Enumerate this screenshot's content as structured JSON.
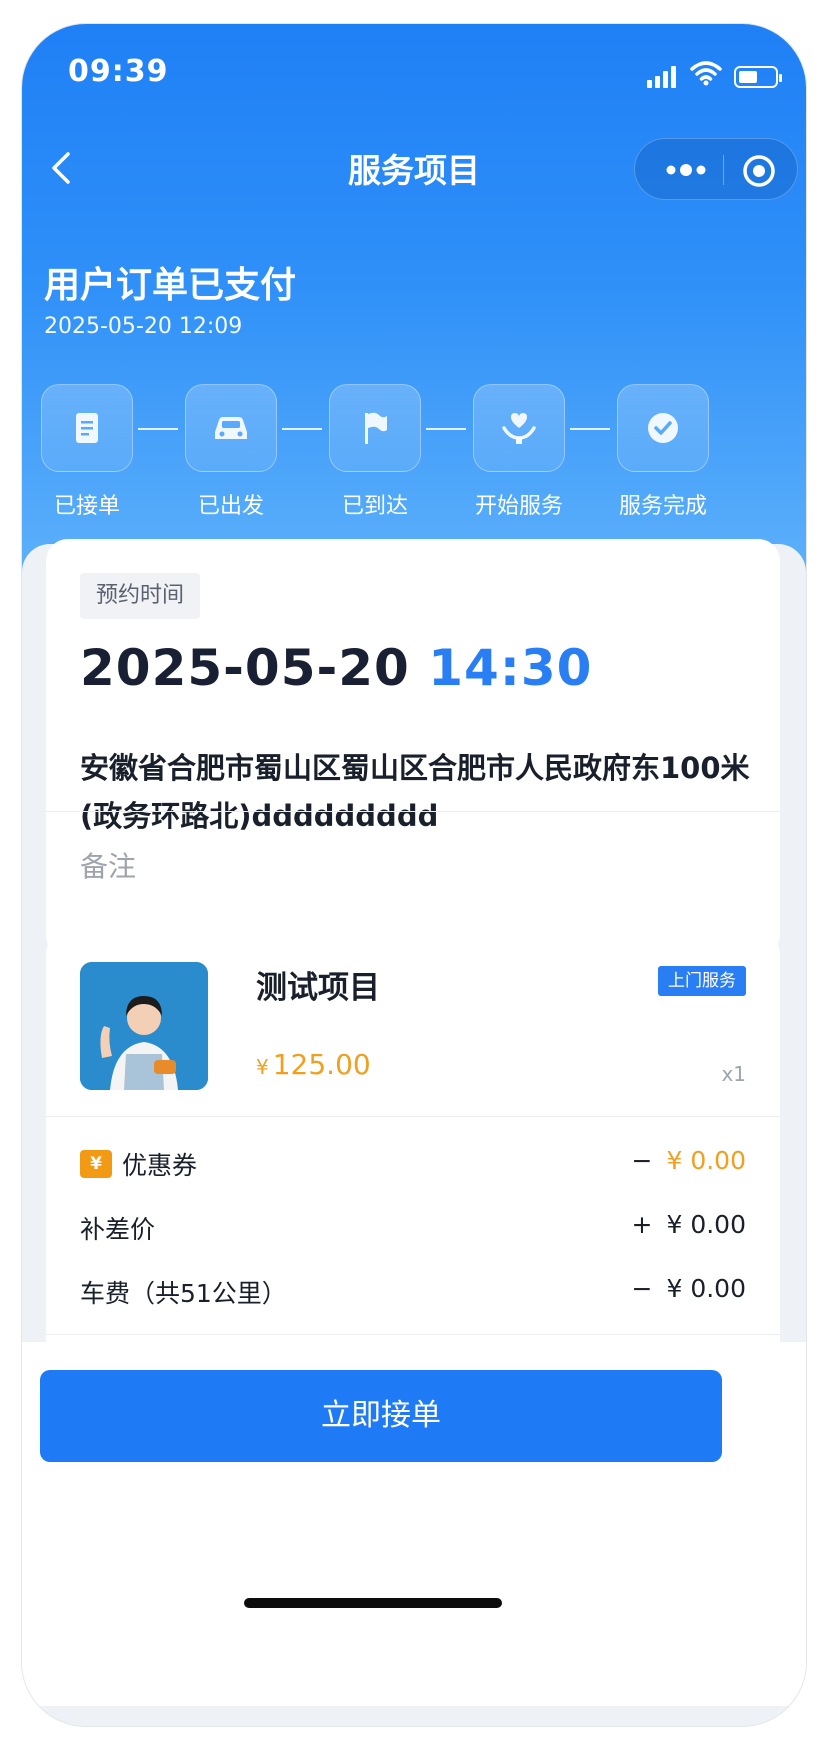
{
  "status_bar": {
    "time": "09:39"
  },
  "navbar": {
    "title": "服务项目"
  },
  "order": {
    "status_title": "用户订单已支付",
    "status_time": "2025-05-20 12:09"
  },
  "steps": [
    {
      "label": "已接单",
      "icon": "document-icon"
    },
    {
      "label": "已出发",
      "icon": "car-icon"
    },
    {
      "label": "已到达",
      "icon": "flag-icon"
    },
    {
      "label": "开始服务",
      "icon": "hand-heart-icon"
    },
    {
      "label": "服务完成",
      "icon": "check-circle-icon"
    }
  ],
  "appointment": {
    "tag": "预约时间",
    "date": "2025-05-20",
    "time": "14:30",
    "address": "安徽省合肥市蜀山区蜀山区合肥市人民政府东100米(政务环路北)ddddddddd",
    "remark_placeholder": "备注"
  },
  "service": {
    "name": "测试项目",
    "tag": "上门服务",
    "currency": "¥",
    "price": "125.00",
    "quantity": "x1"
  },
  "fees": [
    {
      "label": "优惠券",
      "sign": "−",
      "amount": "¥ 0.00",
      "has_icon": true
    },
    {
      "label": "补差价",
      "sign": "+",
      "amount": "¥ 0.00"
    },
    {
      "label": "车费（共51公里）",
      "sign": "−",
      "amount": "¥ 0.00"
    }
  ],
  "actions": {
    "accept_label": "立即接单"
  },
  "colors": {
    "primary": "#1f7af5",
    "price_orange": "#f0a020",
    "text_dark": "#1a2033",
    "background": "#eef1f5"
  }
}
